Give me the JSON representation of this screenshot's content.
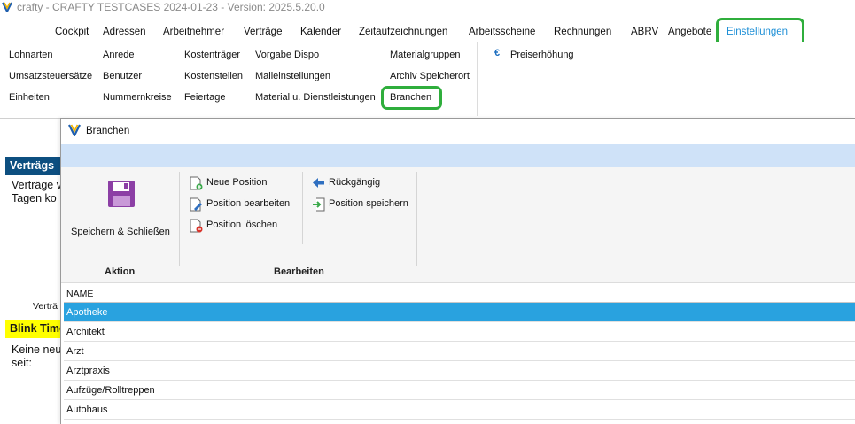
{
  "window": {
    "title": "crafty - CRAFTY TESTCASES 2024-01-23 - Version: 2025.5.20.0"
  },
  "menu": {
    "items": [
      {
        "label": "Cockpit"
      },
      {
        "label": "Adressen"
      },
      {
        "label": "Arbeitnehmer"
      },
      {
        "label": "Verträge"
      },
      {
        "label": "Kalender"
      },
      {
        "label": "Zeitaufzeichnungen"
      },
      {
        "label": "Arbeitsscheine"
      },
      {
        "label": "Rechnungen"
      },
      {
        "label": "ABRV"
      },
      {
        "label": "Angebote"
      },
      {
        "label": "Einstellungen",
        "active": true
      }
    ]
  },
  "ribbon": {
    "col1": [
      "Lohnarten",
      "Umsatzsteuersätze",
      "Einheiten"
    ],
    "col2": [
      "Anrede",
      "Benutzer",
      "Nummernkreise"
    ],
    "col3": [
      "Kostenträger",
      "Kostenstellen",
      "Feiertage"
    ],
    "col4": [
      "Vorgabe Dispo",
      "Maileinstellungen",
      "Material u. Dienstleistungen"
    ],
    "col5": [
      "Materialgruppen",
      "Archiv Speicherort",
      "Branchen"
    ],
    "col6": [
      "Preiserhöhung"
    ],
    "col6_icon": "€"
  },
  "background": {
    "section_header": "Verträgs",
    "line1": "Verträge v",
    "line2": "Tagen ko",
    "label": "Verträ",
    "yellow_header": "Blink Time",
    "line3": "Keine neu",
    "line4": "seit:"
  },
  "dialog": {
    "title": "Branchen",
    "toolbar": {
      "save_close": "Speichern & Schließen",
      "new_position": "Neue Position",
      "edit_position": "Position bearbeiten",
      "delete_position": "Position löschen",
      "undo": "Rückgängig",
      "save_position": "Position speichern",
      "group_action": "Aktion",
      "group_edit": "Bearbeiten"
    },
    "grid": {
      "column": "NAME",
      "rows": [
        "Apotheke",
        "Architekt",
        "Arzt",
        "Arztpraxis",
        "Aufzüge/Rolltreppen",
        "Autohaus"
      ],
      "selected_index": 0
    }
  },
  "colors": {
    "accent_menu": "#1e8fd6",
    "highlight_box": "#2fae3c",
    "selection": "#29a2df",
    "dialog_strip": "#cfe2f8",
    "bg_header_blue": "#0d4f80",
    "bg_header_yellow": "#ffff00"
  }
}
